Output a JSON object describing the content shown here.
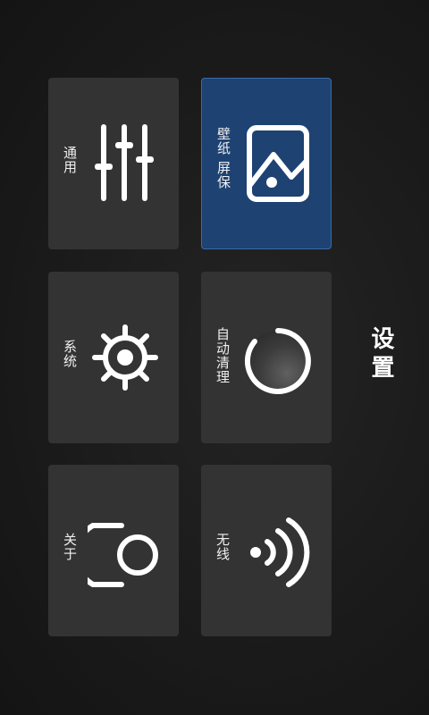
{
  "title": "设置",
  "tiles": {
    "general": {
      "label": "通用",
      "icon": "equalizer-icon"
    },
    "wallpaper": {
      "label": "壁纸 屏保",
      "icon": "picture-icon",
      "selected": true
    },
    "system": {
      "label": "系统",
      "icon": "ship-wheel-icon"
    },
    "autoclean": {
      "label": "自动清理",
      "icon": "ring-gauge-icon"
    },
    "about": {
      "label": "关于",
      "icon": "person-icon"
    },
    "wireless": {
      "label": "无线",
      "icon": "wifi-icon"
    }
  },
  "colors": {
    "background": "#1a1a1a",
    "tile": "#333333",
    "selected_tile": "#1e4272",
    "selected_border": "#3a6aa8",
    "icon": "#ffffff"
  }
}
